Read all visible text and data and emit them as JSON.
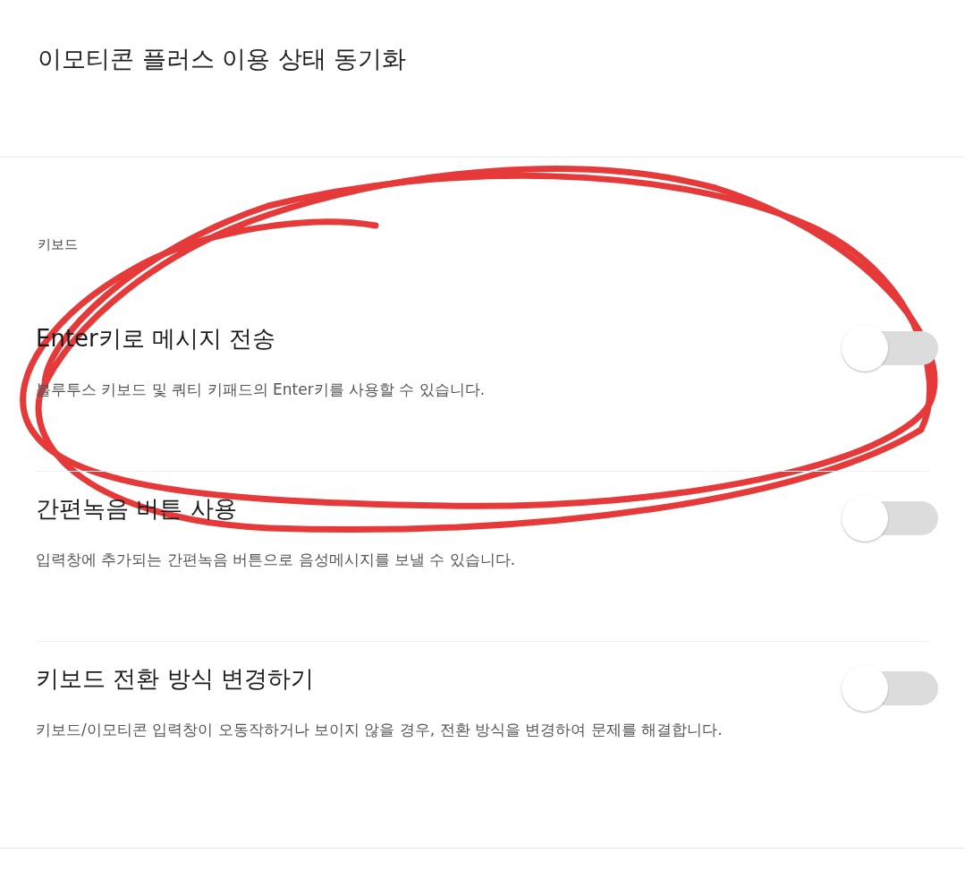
{
  "top_item": {
    "title": "이모티콘 플러스 이용 상태 동기화"
  },
  "section": {
    "label": "키보드"
  },
  "settings": [
    {
      "title": "Enter키로 메시지 전송",
      "description": "블루투스 키보드 및 쿼티 키패드의 Enter키를 사용할 수 있습니다.",
      "on": false
    },
    {
      "title": "간편녹음 버튼 사용",
      "description": "입력창에 추가되는 간편녹음 버튼으로 음성메시지를 보낼 수 있습니다.",
      "on": false
    },
    {
      "title": "키보드 전환 방식 변경하기",
      "description": "키보드/이모티콘 입력창이 오동작하거나 보이지 않을 경우, 전환 방식을 변경하여 문제를 해결합니다.",
      "on": false
    }
  ]
}
